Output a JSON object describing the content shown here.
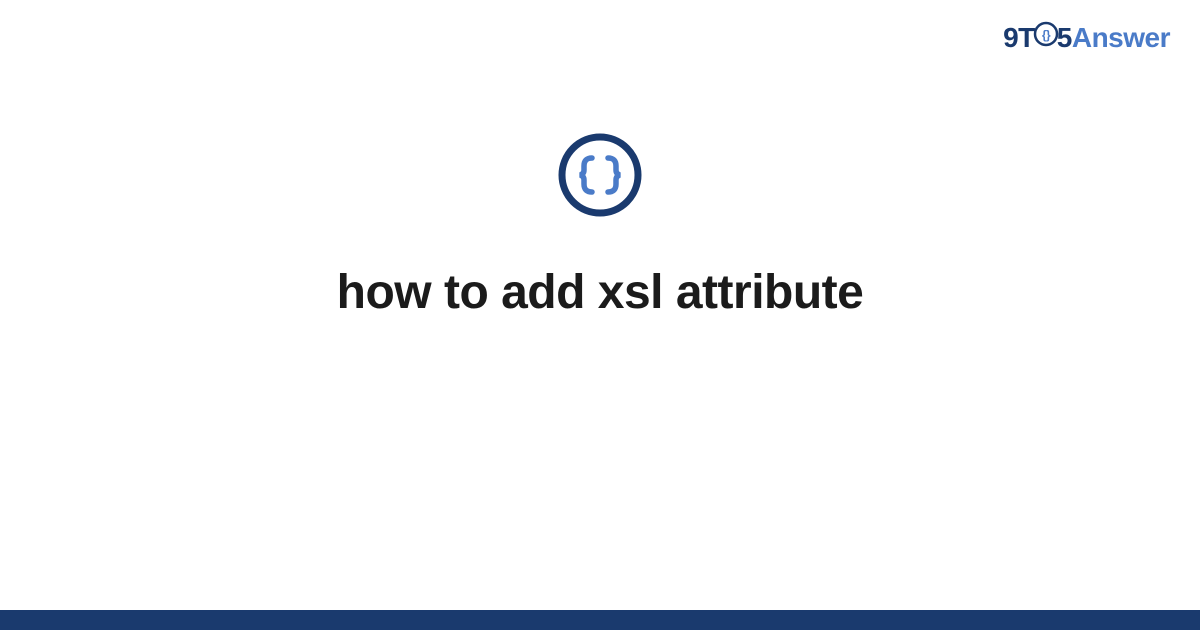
{
  "brand": {
    "part1": "9T",
    "part2": "5",
    "part3": "Answer"
  },
  "title": "how to add xsl attribute",
  "colors": {
    "dark_blue": "#1a3a6e",
    "light_blue": "#4a7bc8",
    "text": "#1b1b1b"
  }
}
